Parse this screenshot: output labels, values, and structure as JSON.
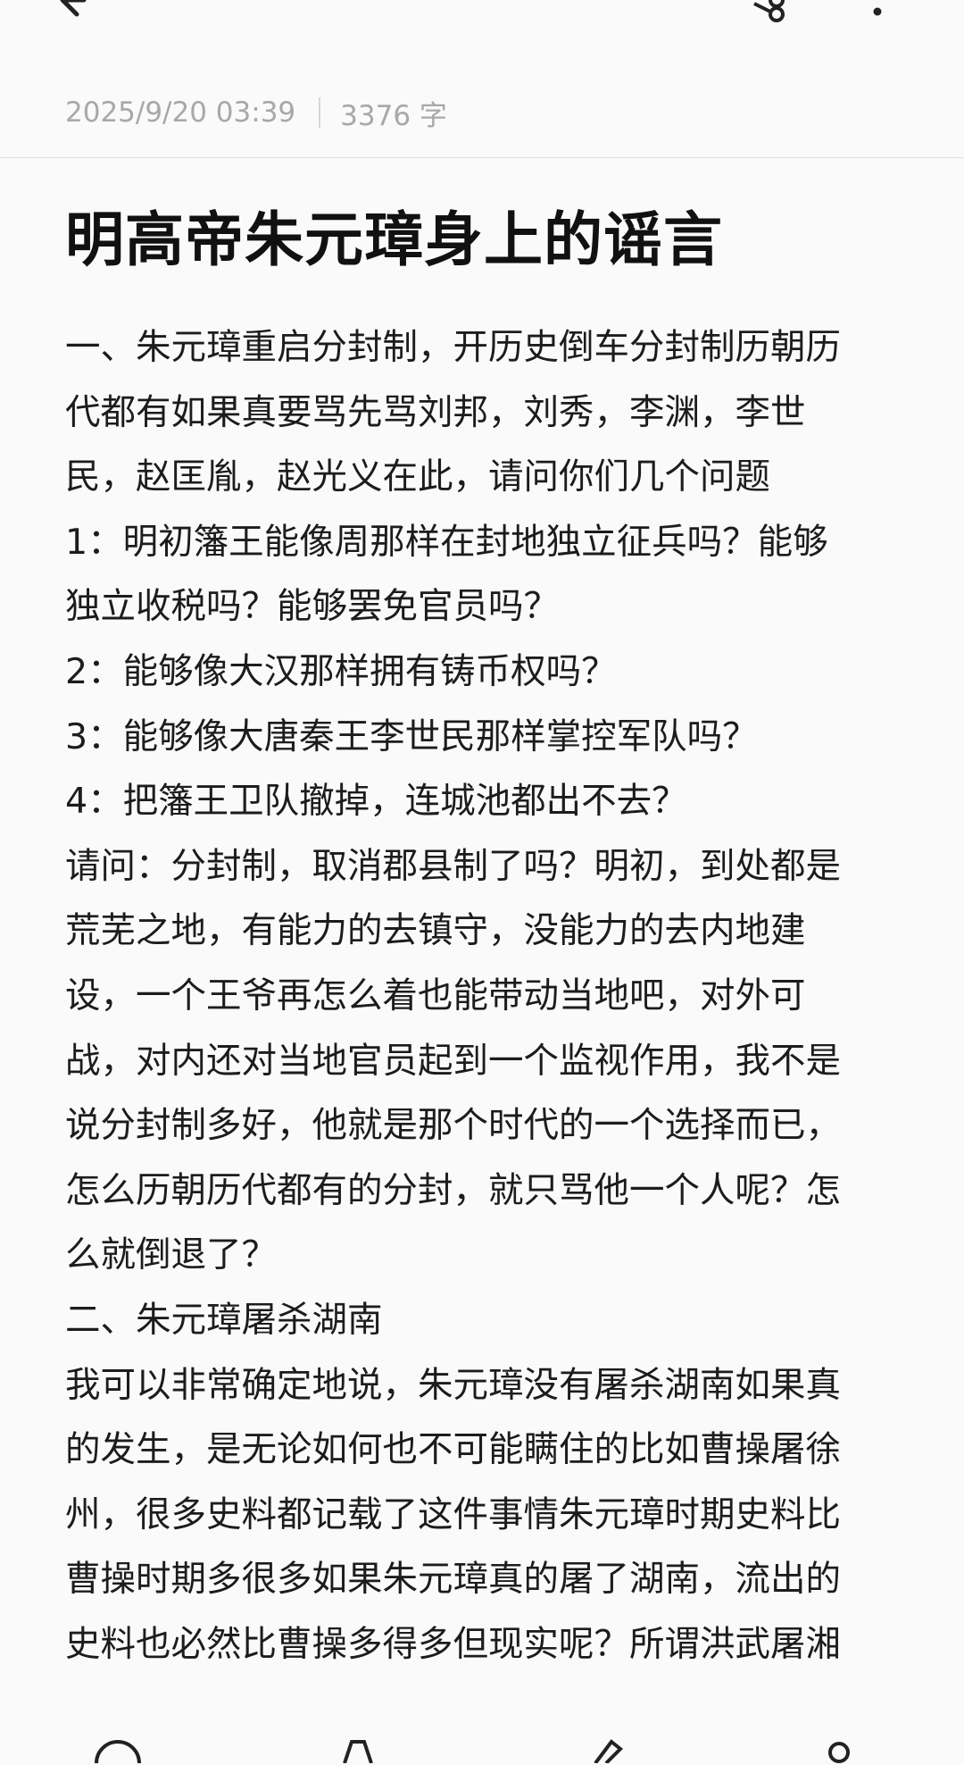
{
  "meta": {
    "date": "2025/9/20 03:39",
    "word_count": "3376 字"
  },
  "article": {
    "title": "明高帝朱元璋身上的谣言",
    "lines": [
      "一、朱元璋重启分封制，开历史倒车分封制历朝历",
      "代都有如果真要骂先骂刘邦，刘秀，李渊，李世",
      "民，赵匡胤，赵光义在此，请问你们几个问题",
      "1：明初籓王能像周那样在封地独立征兵吗？能够",
      "独立收税吗？能够罢免官员吗？",
      "2：能够像大汉那样拥有铸币权吗？",
      "3：能够像大唐秦王李世民那样掌控军队吗？",
      "4：把籓王卫队撤掉，连城池都出不去？",
      "请问：分封制，取消郡县制了吗？明初，到处都是",
      "荒芜之地，有能力的去镇守，没能力的去内地建",
      "设，一个王爷再怎么着也能带动当地吧，对外可",
      "战，对内还对当地官员起到一个监视作用，我不是",
      "说分封制多好，他就是那个时代的一个选择而已，",
      "怎么历朝历代都有的分封，就只骂他一个人呢？怎",
      "么就倒退了？",
      "二、朱元璋屠杀湖南",
      "我可以非常确定地说，朱元璋没有屠杀湖南如果真",
      "的发生，是无论如何也不可能瞒住的比如曹操屠徐",
      "州，很多史料都记载了这件事情朱元璋时期史料比",
      "曹操时期多很多如果朱元璋真的屠了湖南，流出的",
      "史料也必然比曹操多得多但现实呢？所谓洪武屠湘"
    ]
  },
  "icons": {
    "back": "arrow-left-icon",
    "share": "share-icon",
    "more": "more-vertical-icon"
  }
}
